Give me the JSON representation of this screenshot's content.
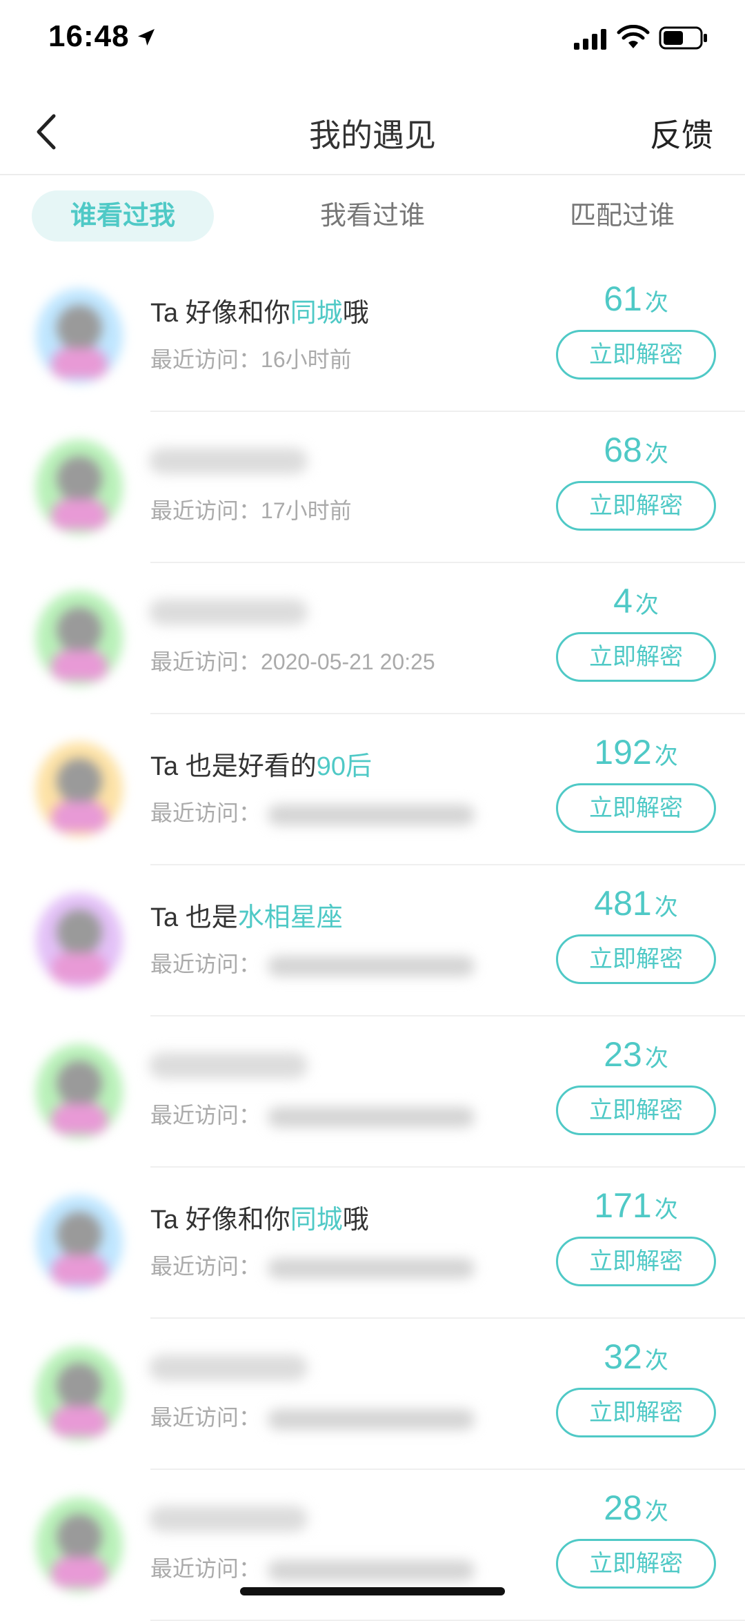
{
  "status_bar": {
    "time": "16:48",
    "battery_level": 0.55
  },
  "nav": {
    "title": "我的遇见",
    "feedback": "反馈"
  },
  "tabs": [
    {
      "label": "谁看过我",
      "active": true
    },
    {
      "label": "我看过谁",
      "active": false
    },
    {
      "label": "匹配过谁",
      "active": false
    }
  ],
  "visit_label": "最近访问：",
  "count_unit": "次",
  "unlock_label": "立即解密",
  "accent_color": "#4fc9c6",
  "rows": [
    {
      "avatar_bg": "#bfe6ff",
      "title_pre": "Ta 好像和你",
      "title_hl": "同城",
      "title_post": "哦",
      "visit_time": "16小时前",
      "count": "61"
    },
    {
      "avatar_bg": "#b9f1b9",
      "title_pre": "",
      "title_hl": "",
      "title_post": "",
      "visit_time": "17小时前",
      "count": "68"
    },
    {
      "avatar_bg": "#b9f1b9",
      "title_pre": "",
      "title_hl": "",
      "title_post": "",
      "visit_time": "2020-05-21 20:25",
      "count": "4"
    },
    {
      "avatar_bg": "#fde2a6",
      "title_pre": "Ta 也是好看的",
      "title_hl": "90后",
      "title_post": "",
      "visit_time": "",
      "count": "192"
    },
    {
      "avatar_bg": "#e3c1f7",
      "title_pre": "Ta 也是",
      "title_hl": "水相星座",
      "title_post": "",
      "visit_time": "",
      "count": "481"
    },
    {
      "avatar_bg": "#b9f1b9",
      "title_pre": "",
      "title_hl": "",
      "title_post": "",
      "visit_time": "",
      "count": "23"
    },
    {
      "avatar_bg": "#bfe6ff",
      "title_pre": "Ta 好像和你",
      "title_hl": "同城",
      "title_post": "哦",
      "visit_time": "",
      "count": "171"
    },
    {
      "avatar_bg": "#b9f1b9",
      "title_pre": "",
      "title_hl": "",
      "title_post": "",
      "visit_time": "",
      "count": "32"
    },
    {
      "avatar_bg": "#b9f1b9",
      "title_pre": "",
      "title_hl": "",
      "title_post": "",
      "visit_time": "",
      "count": "28"
    }
  ]
}
